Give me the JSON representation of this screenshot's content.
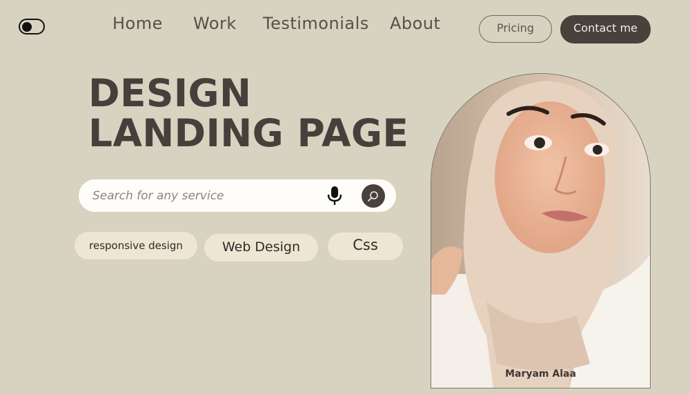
{
  "nav": {
    "home": "Home",
    "work": "Work",
    "testimonials": "Testimonials",
    "about": "About",
    "pricing": "Pricing",
    "contact": "Contact me"
  },
  "hero": {
    "line1": "DESIGN",
    "line2": "LANDING PAGE"
  },
  "search": {
    "placeholder": "Search for any service"
  },
  "chips": [
    "responsive design",
    "Web Design",
    "Css"
  ],
  "portrait": {
    "name": "Maryam Alaa"
  },
  "colors": {
    "background": "#d8d2c0",
    "primary_dark": "#48413c",
    "chip": "#efe5d3",
    "search_bg": "#fffdf9"
  },
  "icons": {
    "toggle": "theme-toggle-icon",
    "mic": "microphone-icon",
    "search": "search-icon"
  }
}
